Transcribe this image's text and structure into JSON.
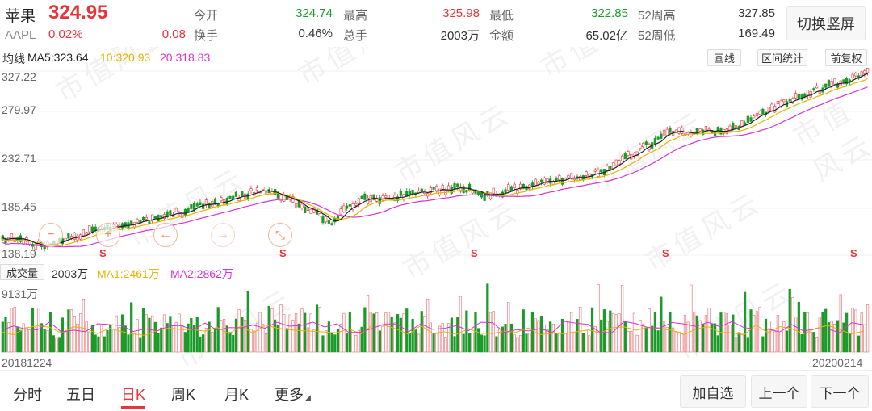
{
  "quote": {
    "name": "苹果",
    "price": "324.95",
    "code": "AAPL",
    "pct": "0.02%",
    "change": "0.08",
    "fields": [
      {
        "label": "今开",
        "value": "324.74",
        "color": "green"
      },
      {
        "label": "最高",
        "value": "325.98",
        "color": "red"
      },
      {
        "label": "最低",
        "value": "322.85",
        "color": "green"
      },
      {
        "label": "52周高",
        "value": "327.85",
        "color": "dark"
      },
      {
        "label": "换手",
        "value": "0.46%",
        "color": "dark"
      },
      {
        "label": "总手",
        "value": "2003万",
        "color": "dark"
      },
      {
        "label": "金额",
        "value": "65.02亿",
        "color": "dark"
      },
      {
        "label": "52周低",
        "value": "169.49",
        "color": "dark"
      }
    ],
    "switch_label": "切换竖屏"
  },
  "ma": {
    "label": "均线",
    "ma5": "MA5:323.64",
    "ma10": "10:320.93",
    "ma20": "20:318.83",
    "colors": {
      "ma5": "#222222",
      "ma10": "#e5b400",
      "ma20": "#d633d6"
    }
  },
  "tools": {
    "draw": "画线",
    "range_stats": "区间统计",
    "adjust": "前复权"
  },
  "kline_axis": {
    "labels": [
      "327.22",
      "279.97",
      "232.71",
      "185.45",
      "138.19"
    ]
  },
  "volume": {
    "badge": "成交量",
    "current": "2003万",
    "ma1": "MA1:2461万",
    "ma2": "MA2:2862万",
    "max_label": "9131万",
    "start_date": "20181224",
    "end_date": "20200214"
  },
  "signals": [
    "S",
    "S",
    "S",
    "S",
    "S"
  ],
  "nav": {
    "tabs": [
      "分时",
      "五日",
      "日K",
      "周K",
      "月K",
      "更多"
    ],
    "active_index": 2,
    "add_watch": "加自选",
    "prev": "上一个",
    "next": "下一个"
  },
  "watermark_text": "市值风云",
  "colors": {
    "up": "#e8333a",
    "down": "#1a9a29",
    "accent": "#e8333a"
  }
}
